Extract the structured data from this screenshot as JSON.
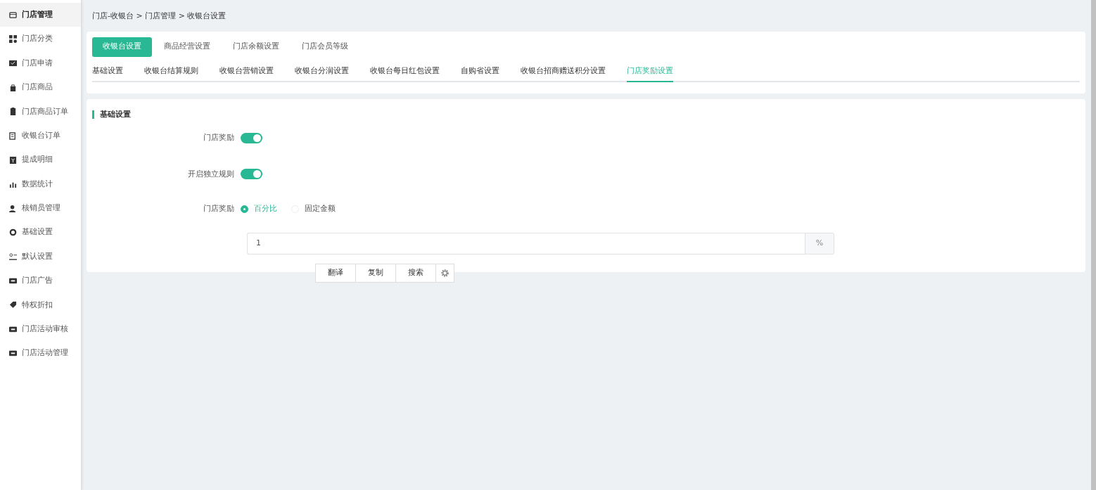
{
  "sidebar": {
    "items": [
      {
        "label": "门店管理",
        "selected": true
      },
      {
        "label": "门店分类",
        "selected": false
      },
      {
        "label": "门店申请",
        "selected": false
      },
      {
        "label": "门店商品",
        "selected": false
      },
      {
        "label": "门店商品订单",
        "selected": false
      },
      {
        "label": "收银台订单",
        "selected": false
      },
      {
        "label": "提成明细",
        "selected": false
      },
      {
        "label": "数据统计",
        "selected": false
      },
      {
        "label": "核销员管理",
        "selected": false
      },
      {
        "label": "基础设置",
        "selected": false
      },
      {
        "label": "默认设置",
        "selected": false
      },
      {
        "label": "门店广告",
        "selected": false
      },
      {
        "label": "特权折扣",
        "selected": false
      },
      {
        "label": "门店活动审核",
        "selected": false
      },
      {
        "label": "门店活动管理",
        "selected": false
      }
    ]
  },
  "breadcrumb": "门店-收银台 > 门店管理 > 收银台设置",
  "primary_tabs": [
    {
      "label": "收银台设置",
      "selected": true
    },
    {
      "label": "商品经营设置",
      "selected": false
    },
    {
      "label": "门店余额设置",
      "selected": false
    },
    {
      "label": "门店会员等级",
      "selected": false
    }
  ],
  "sub_tabs": [
    {
      "label": "基础设置",
      "selected": false
    },
    {
      "label": "收银台结算规则",
      "selected": false
    },
    {
      "label": "收银台营销设置",
      "selected": false
    },
    {
      "label": "收银台分润设置",
      "selected": false
    },
    {
      "label": "收银台每日红包设置",
      "selected": false
    },
    {
      "label": "自购省设置",
      "selected": false
    },
    {
      "label": "收银台招商赠送积分设置",
      "selected": false
    },
    {
      "label": "门店奖励设置",
      "selected": true
    }
  ],
  "section": {
    "title": "基础设置",
    "fields": [
      {
        "kind": "toggle",
        "label": "门店奖励",
        "on": true
      },
      {
        "kind": "toggle",
        "label": "开启独立规则",
        "on": true
      },
      {
        "kind": "radio",
        "label": "门店奖励",
        "options": [
          {
            "label": "百分比",
            "selected": true
          },
          {
            "label": "固定金额",
            "selected": false
          }
        ]
      },
      {
        "kind": "input",
        "value": "1",
        "addon": "%"
      }
    ]
  },
  "popup": {
    "buttons": [
      "翻译",
      "复制",
      "搜索"
    ]
  }
}
